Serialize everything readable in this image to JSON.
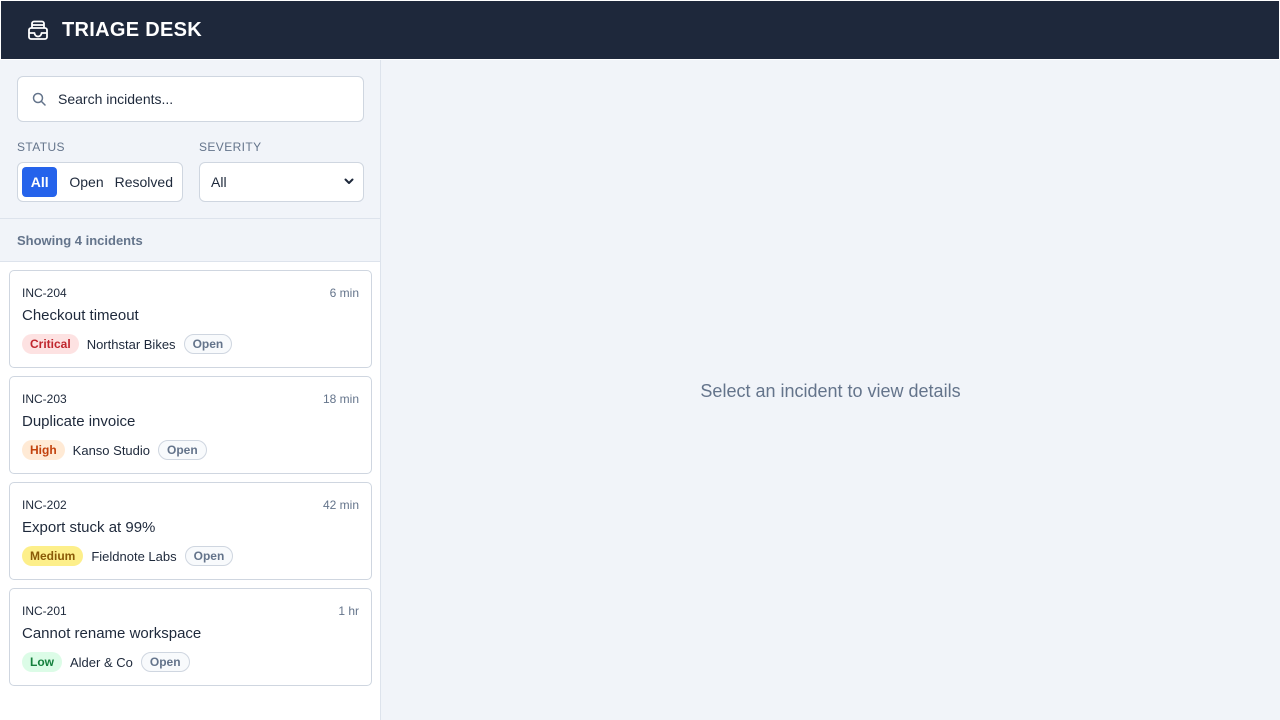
{
  "app": {
    "title": "TRIAGE DESK",
    "logo_icon": "inbox-tray-icon"
  },
  "search": {
    "placeholder": "Search incidents..."
  },
  "filters": {
    "status_label": "STATUS",
    "status_options": [
      "All",
      "Open",
      "Resolved"
    ],
    "status_selected": "All",
    "severity_label": "SEVERITY",
    "severity_value": "All"
  },
  "list": {
    "count_text": "Showing 4 incidents",
    "incidents": [
      {
        "id": "INC-204",
        "time": "6 min",
        "title": "Checkout timeout",
        "severity": "Critical",
        "customer": "Northstar Bikes",
        "status": "Open"
      },
      {
        "id": "INC-203",
        "time": "18 min",
        "title": "Duplicate invoice",
        "severity": "High",
        "customer": "Kanso Studio",
        "status": "Open"
      },
      {
        "id": "INC-202",
        "time": "42 min",
        "title": "Export stuck at 99%",
        "severity": "Medium",
        "customer": "Fieldnote Labs",
        "status": "Open"
      },
      {
        "id": "INC-201",
        "time": "1 hr",
        "title": "Cannot rename workspace",
        "severity": "Low",
        "customer": "Alder & Co",
        "status": "Open"
      }
    ]
  },
  "main": {
    "empty_message": "Select an incident to view details"
  },
  "colors": {
    "header_bg": "#1e283b",
    "accent": "#2563eb",
    "critical": "#c0262d",
    "high": "#c2410c",
    "medium": "#8a5a06",
    "low": "#15803d"
  }
}
